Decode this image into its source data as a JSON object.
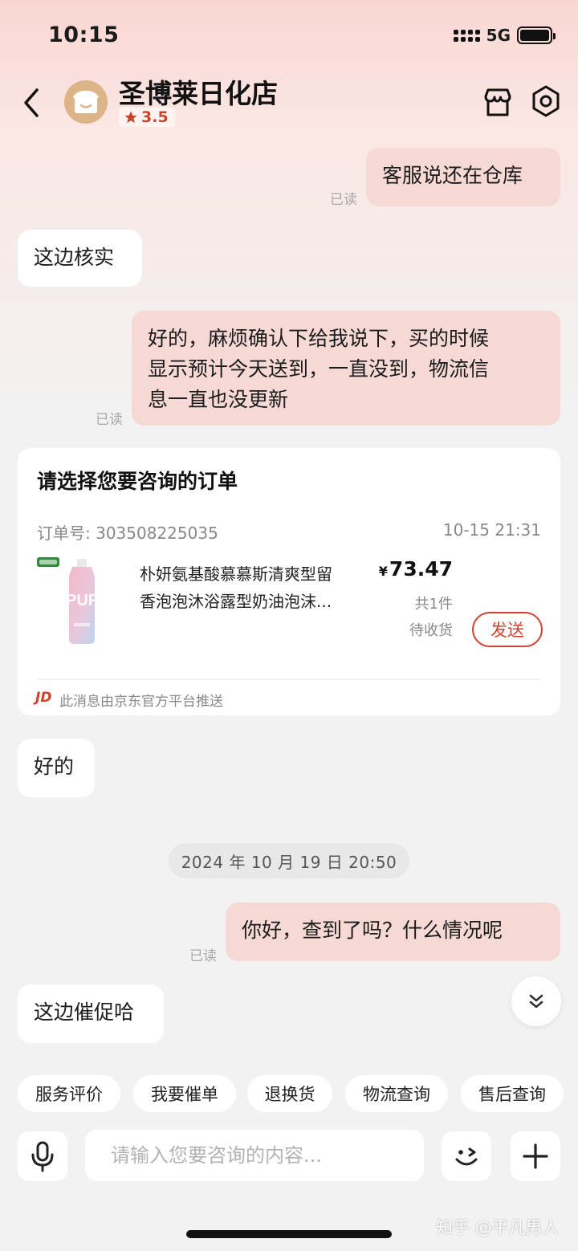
{
  "status_bar": {
    "time": "10:15",
    "network": "5G"
  },
  "header": {
    "shop_name": "圣博莱日化店",
    "rating": "3.5",
    "icons": [
      "back-icon",
      "shop-avatar-icon",
      "star-icon",
      "store-icon",
      "settings-icon"
    ]
  },
  "messages": [
    {
      "side": "out",
      "text": "客服说还在仓库",
      "read": "已读"
    },
    {
      "side": "in",
      "text": "这边核实"
    },
    {
      "side": "out",
      "lines": [
        "好的，麻烦确认下给我说下，买的时候",
        "显示预计今天送到，一直没到，物流信",
        "息一直也没更新"
      ],
      "read": "已读"
    },
    {
      "side": "in",
      "text": "好的"
    },
    {
      "side": "out",
      "text": "你好，查到了吗？什么情况呢",
      "read": "已读"
    },
    {
      "side": "in",
      "text": "这边催促哈"
    }
  ],
  "order_card": {
    "title": "请选择您要咨询的订单",
    "order_no": "订单号: 303508225035",
    "order_time": "10-15 21:31",
    "product_name_lines": [
      "朴妍氨基酸慕慕斯清爽型留",
      "香泡泡沐浴露型奶油泡沫..."
    ],
    "currency": "¥",
    "price": "73.47",
    "quantity": "共1件",
    "status": "待收货",
    "send_label": "发送",
    "platform_logo": "JD",
    "platform_note": "此消息由京东官方平台推送",
    "product_image": {
      "label": "PUF",
      "colors": [
        "#f4b8c8",
        "#bcd4f0",
        "#ffffff"
      ]
    }
  },
  "date_separator": "2024 年 10 月 19 日  20:50",
  "quick_replies": [
    "服务评价",
    "我要催单",
    "退换货",
    "物流查询",
    "售后查询"
  ],
  "input": {
    "placeholder": "请输入您要咨询的内容..."
  },
  "bottom_icons": [
    "microphone-icon",
    "emoji-icon",
    "plus-icon",
    "scroll-down-icon"
  ],
  "watermark": "知乎 @平凡男人",
  "colors": {
    "accent": "#d2402e",
    "outgoing_bubble": "#f6d9d5",
    "incoming_bubble": "#ffffff",
    "background": "#f2f2f2"
  }
}
